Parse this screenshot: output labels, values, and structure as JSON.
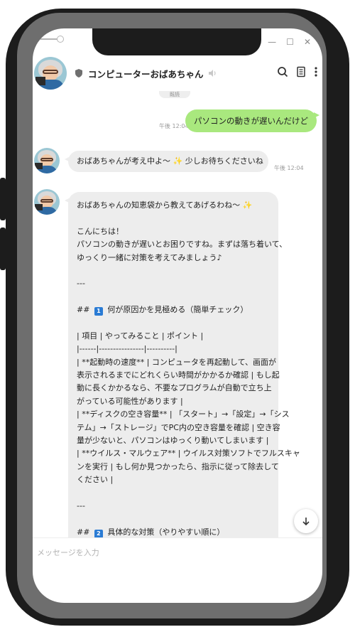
{
  "header": {
    "title": "コンピューターおばあちゃん"
  },
  "chat": {
    "top_pill": "既読",
    "user_message": {
      "text": "パソコンの動きが遅いんだけど",
      "time": "午後 12:04"
    },
    "bot_status": {
      "text": "おばあちゃんが考え中よ～ ✨ 少しお待ちくださいね",
      "time": "午後 12:04"
    },
    "bot_reply_lines": [
      "おばあちゃんの知恵袋から教えてあげるわね～ ✨",
      "",
      "こんにちは！",
      "パソコンの動きが遅いとお困りですね。まずは落ち着いて、",
      "ゆっくり一緒に対策を考えてみましょう♪",
      "",
      "---",
      "",
      "## [1] 何が原因かを見極める（簡単チェック）",
      "",
      "| 項目 | やってみること | ポイント |",
      "|------|----------------|----------|",
      "| **起動時の速度** | コンピュータを再起動して、画面が",
      "表示されるまでにどれくらい時間がかかるか確認 | もし起",
      "動に長くかかるなら、不要なプログラムが自動で立ち上",
      "がっている可能性があります |",
      "| **ディスクの空き容量** | 「スタート」→「設定」→「シス",
      "テム」→「ストレージ」でPC内の空き容量を確認 | 空き容",
      "量が少ないと、パソコンはゆっくり動いてしまいます |",
      "| **ウイルス・マルウェア** | ウイルス対策ソフトでフルスキャ",
      "ンを実行 | もし何か見つかったら、指示に従って除去して",
      "ください |",
      "",
      "---",
      "",
      "## [2] 具体的な対策（やりやすい順に）"
    ]
  },
  "input": {
    "placeholder": "メッセージを入力"
  },
  "colors": {
    "user_bubble": "#a9e87e",
    "bot_bubble": "#ededed",
    "badge": "#2a7bd4"
  },
  "icons": [
    "shield-icon",
    "speaker-icon",
    "search-icon",
    "menu-icon",
    "more-vertical-icon",
    "arrow-down-icon"
  ]
}
